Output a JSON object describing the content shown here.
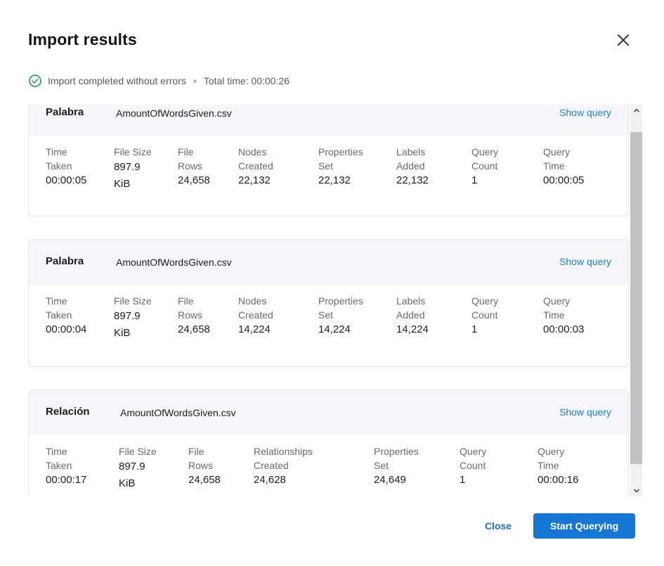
{
  "dialog": {
    "title": "Import results",
    "status_text": "Import completed without errors",
    "total_time": "Total time: 00:00:26",
    "close_label": "Close",
    "start_label": "Start Querying",
    "icons": {
      "close": "close-x-icon",
      "status": "check-circle-icon"
    },
    "colors": {
      "accent": "#1677d2",
      "link": "#1f7fc7",
      "success": "#2e9e5b"
    }
  },
  "cards": [
    {
      "kind": "Palabra",
      "file": "AmountOfWordsGiven.csv",
      "show_query": "Show query",
      "stats": [
        {
          "label": "Time\nTaken",
          "value": "00:00:05"
        },
        {
          "label": "File Size",
          "value": "897.9\nKiB"
        },
        {
          "label": "File\nRows",
          "value": "24,658"
        },
        {
          "label": "Nodes\nCreated",
          "value": "22,132"
        },
        {
          "label": "Properties\nSet",
          "value": "22,132"
        },
        {
          "label": "Labels\nAdded",
          "value": "22,132"
        },
        {
          "label": "Query\nCount",
          "value": "1"
        },
        {
          "label": "Query\nTime",
          "value": "00:00:05"
        }
      ]
    },
    {
      "kind": "Palabra",
      "file": "AmountOfWordsGiven.csv",
      "show_query": "Show query",
      "stats": [
        {
          "label": "Time\nTaken",
          "value": "00:00:04"
        },
        {
          "label": "File Size",
          "value": "897.9\nKiB"
        },
        {
          "label": "File\nRows",
          "value": "24,658"
        },
        {
          "label": "Nodes\nCreated",
          "value": "14,224"
        },
        {
          "label": "Properties\nSet",
          "value": "14,224"
        },
        {
          "label": "Labels\nAdded",
          "value": "14,224"
        },
        {
          "label": "Query\nCount",
          "value": "1"
        },
        {
          "label": "Query\nTime",
          "value": "00:00:03"
        }
      ]
    },
    {
      "kind": "Relación",
      "file": "AmountOfWordsGiven.csv",
      "show_query": "Show query",
      "stats": [
        {
          "label": "Time\nTaken",
          "value": "00:00:17"
        },
        {
          "label": "File Size",
          "value": "897.9\nKiB"
        },
        {
          "label": "File\nRows",
          "value": "24,658"
        },
        {
          "label": "Relationships\nCreated",
          "value": "24,628"
        },
        {
          "label": "Properties\nSet",
          "value": "24,649"
        },
        {
          "label": "Query\nCount",
          "value": "1"
        },
        {
          "label": "Query\nTime",
          "value": "00:00:16"
        }
      ]
    }
  ]
}
